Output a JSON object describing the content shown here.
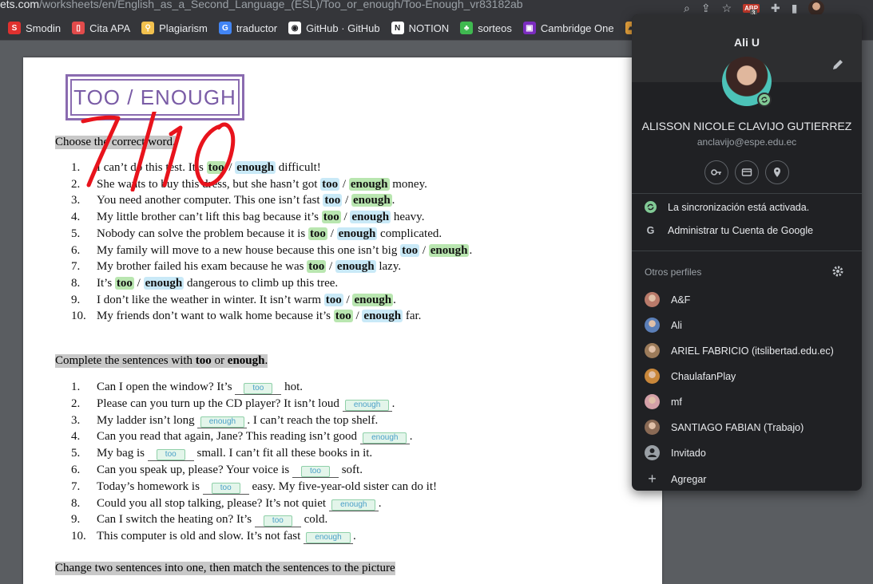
{
  "browser": {
    "url_host": "ets.com",
    "url_path": "/worksheets/en/English_as_a_Second_Language_(ESL)/Too_or_enough/Too-Enough_vr83182ab",
    "extension_badge": "ABP",
    "extension_count": "3"
  },
  "bookmarks": [
    {
      "label": "Smodin",
      "color": "#e0312f"
    },
    {
      "label": "Cita APA",
      "color": "#e24b4b"
    },
    {
      "label": "Plagiarism",
      "color": "#f2c14e"
    },
    {
      "label": "traductor",
      "color": "#4285f4"
    },
    {
      "label": "GitHub · GitHub",
      "color": "#ffffff"
    },
    {
      "label": "NOTION",
      "color": "#ffffff"
    },
    {
      "label": "sorteos",
      "color": "#3fb950"
    },
    {
      "label": "Cambridge One",
      "color": "#7b2cbf"
    }
  ],
  "worksheet": {
    "title": "TOO / ENOUGH",
    "score": "7/10",
    "section1": "Choose the correct word.",
    "section1_rows": [
      {
        "num": "1.",
        "pre": "I can’t do this test. It’s ",
        "w1": "too",
        "w2": "enough",
        "post": " difficult!",
        "sel": 1
      },
      {
        "num": "2.",
        "pre": "She wants to buy this dress, but she hasn’t got ",
        "w1": "too",
        "w2": "enough",
        "post": " money.",
        "sel": 2
      },
      {
        "num": "3.",
        "pre": "You need another computer. This one isn’t fast ",
        "w1": "too",
        "w2": "enough",
        "post": ".",
        "sel": 2
      },
      {
        "num": "4.",
        "pre": "My little brother can’t lift this bag because it’s ",
        "w1": "too",
        "w2": "enough",
        "post": " heavy.",
        "sel": 1
      },
      {
        "num": "5.",
        "pre": "Nobody can solve the problem because it is ",
        "w1": "too",
        "w2": "enough",
        "post": " complicated.",
        "sel": 1
      },
      {
        "num": "6.",
        "pre": "My family will move to a new house because this one isn’t big ",
        "w1": "too",
        "w2": "enough",
        "post": ".",
        "sel": 2
      },
      {
        "num": "7.",
        "pre": "My brother failed his exam because he was ",
        "w1": "too",
        "w2": "enough",
        "post": " lazy.",
        "sel": 1
      },
      {
        "num": "8.",
        "pre": "It’s ",
        "w1": "too",
        "w2": "enough",
        "post": " dangerous to climb up this tree.",
        "sel": 1
      },
      {
        "num": "9.",
        "pre": "I don’t like the weather in winter. It isn’t warm ",
        "w1": "too",
        "w2": "enough",
        "post": ".",
        "sel": 2
      },
      {
        "num": "10.",
        "pre": "My friends don’t want to walk home because it’s ",
        "w1": "too",
        "w2": "enough",
        "post": " far.",
        "sel": 1
      }
    ],
    "section2_pre": "Complete the sentences with ",
    "section2_too": "too",
    "section2_or": " or ",
    "section2_enough": "enough",
    "section2_end": ".",
    "section2_rows": [
      {
        "num": "1.",
        "pre": "Can I open the window? It’s ",
        "ans": "too",
        "post": " hot."
      },
      {
        "num": "2.",
        "pre": "Please can you turn up the CD player? It isn’t loud ",
        "ans": "enough",
        "post": "."
      },
      {
        "num": "3.",
        "pre": "My ladder isn’t long ",
        "ans": "enough",
        "post": ". I can’t reach the top shelf."
      },
      {
        "num": "4.",
        "pre": "Can you read that again, Jane? This reading isn’t good ",
        "ans": "enough",
        "post": "."
      },
      {
        "num": "5.",
        "pre": "My bag is ",
        "ans": "too",
        "post": " small. I can’t fit all these books in it."
      },
      {
        "num": "6.",
        "pre": "Can you speak up, please? Your voice is ",
        "ans": "too",
        "post": " soft."
      },
      {
        "num": "7.",
        "pre": "Today’s homework is ",
        "ans": "too",
        "post": " easy. My five-year-old sister can do it!"
      },
      {
        "num": "8.",
        "pre": "Could you all stop talking, please? It’s not quiet ",
        "ans": "enough",
        "post": "."
      },
      {
        "num": "9.",
        "pre": "Can I switch the heating on? It’s ",
        "ans": "too",
        "post": " cold."
      },
      {
        "num": "10.",
        "pre": "This computer is old and slow. It’s not fast ",
        "ans": "enough",
        "post": "."
      }
    ],
    "section3": "Change two sentences into one, then match the sentences to the picture"
  },
  "profile": {
    "name": "Ali U",
    "full_name": "ALISSON NICOLE CLAVIJO GUTIERREZ",
    "email": "anclavijo@espe.edu.ec",
    "sync_text": "La sincronización está activada.",
    "manage_text": "Administrar tu Cuenta de Google",
    "others_label": "Otros perfiles",
    "others": [
      {
        "label": "A&F",
        "color": "#b97a6a"
      },
      {
        "label": "Ali",
        "color": "#5b7fb8"
      },
      {
        "label": "ARIEL FABRICIO (itslibertad.edu.ec)",
        "color": "#9c7b5a"
      },
      {
        "label": "ChaulafanPlay",
        "color": "#c9873a"
      },
      {
        "label": "mf",
        "color": "#d4a0a8"
      },
      {
        "label": "SANTIAGO FABIAN (Trabajo)",
        "color": "#8a6a55"
      }
    ],
    "guest": "Invitado",
    "add": "Agregar"
  }
}
